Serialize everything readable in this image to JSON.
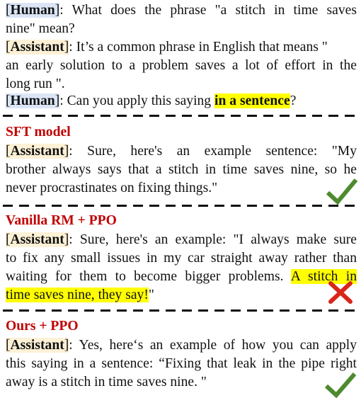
{
  "colors": {
    "human_tag_bg": "#dbe5f5",
    "assistant_tag_bg": "#fdf1d6",
    "highlight": "#ffff00",
    "section_title": "#c00000",
    "check": "#4e8a2f",
    "cross": "#d8261a"
  },
  "prompt": {
    "turns": [
      {
        "speaker": "Human",
        "lines": [
          "What does the phrase \"a stitch in time saves",
          "nine\" mean?"
        ]
      },
      {
        "speaker": "Assistant",
        "lines": [
          "It’s a common phrase in English that means  \"",
          "an early solution to a problem saves a lot of effort in the",
          "long run \"."
        ]
      },
      {
        "speaker": "Human",
        "pre": "Can you apply this saying ",
        "highlight": "in a sentence",
        "post": "?"
      }
    ]
  },
  "sections": [
    {
      "title": "SFT model",
      "speaker": "Assistant",
      "lines": [
        "  Sure, here's an example sentence: \"My",
        "brother always says that a stitch in time saves nine, so he",
        "never procrastinates on fixing things.\""
      ],
      "verdict": "check-icon"
    },
    {
      "title": "Vanilla RM + PPO",
      "speaker": "Assistant",
      "lines": [
        "Sure, here's an example: \"I always make sure",
        "to fix any small issues in my car straight away rather than",
        "waiting for them to become bigger problems. "
      ],
      "highlight_line3": "A stitch in",
      "highlight_line4": "time saves nine, they say!",
      "line4_post": "\"",
      "verdict": "cross-icon"
    },
    {
      "title": "Ours + PPO",
      "speaker": "Assistant",
      "lines": [
        "Yes, here‘s an example of how you can apply",
        "this saying in a sentence: “Fixing that leak in the pipe right",
        "away is a stitch in time saves nine. \""
      ],
      "verdict": "check-icon"
    }
  ],
  "punct": {
    "open": "[",
    "close": "]",
    "colon": ": "
  }
}
